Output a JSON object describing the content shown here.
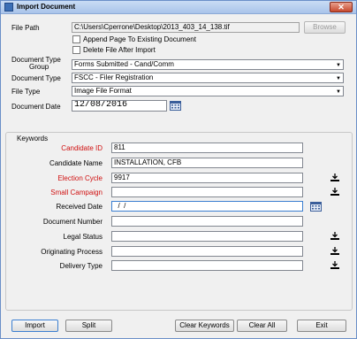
{
  "window": {
    "title": "Import Document",
    "close_label": "✕"
  },
  "file": {
    "path_label": "File Path",
    "path_value": "C:\\Users\\Cperrone\\Desktop\\2013_403_14_138.tif",
    "browse_label": "Browse",
    "append_label": "Append Page To Existing Document",
    "delete_label": "Delete File After Import"
  },
  "fields": {
    "doc_type_group_label_1": "Document Type",
    "doc_type_group_label_2": "Group",
    "doc_type_group_value": "Forms Submitted - Cand/Comm",
    "doc_type_label": "Document Type",
    "doc_type_value": "FSCC - Filer Registration",
    "file_type_label": "File Type",
    "file_type_value": "Image File Format",
    "doc_date_label": "Document Date",
    "doc_date_value": "12/08/2016"
  },
  "keywords": {
    "legend": "Keywords",
    "rows": [
      {
        "label": "Candidate ID",
        "value": "811",
        "required": true
      },
      {
        "label": "Candidate Name",
        "value": "INSTALLATION, CFB",
        "required": false
      },
      {
        "label": "Election Cycle",
        "value": "9917",
        "required": true
      },
      {
        "label": "Small Campaign",
        "value": "",
        "required": true
      },
      {
        "label": "Received Date",
        "value": "  /  /",
        "required": false
      },
      {
        "label": "Document Number",
        "value": "",
        "required": false
      },
      {
        "label": "Legal Status",
        "value": "",
        "required": false
      },
      {
        "label": "Originating Process",
        "value": "",
        "required": false
      },
      {
        "label": "Delivery Type",
        "value": "",
        "required": false
      }
    ]
  },
  "buttons": {
    "import": "Import",
    "split": "Split",
    "clear_keywords": "Clear Keywords",
    "clear_all": "Clear All",
    "exit": "Exit"
  },
  "colors": {
    "required_label": "#d01010",
    "titlebar": "#a9c4ea"
  }
}
